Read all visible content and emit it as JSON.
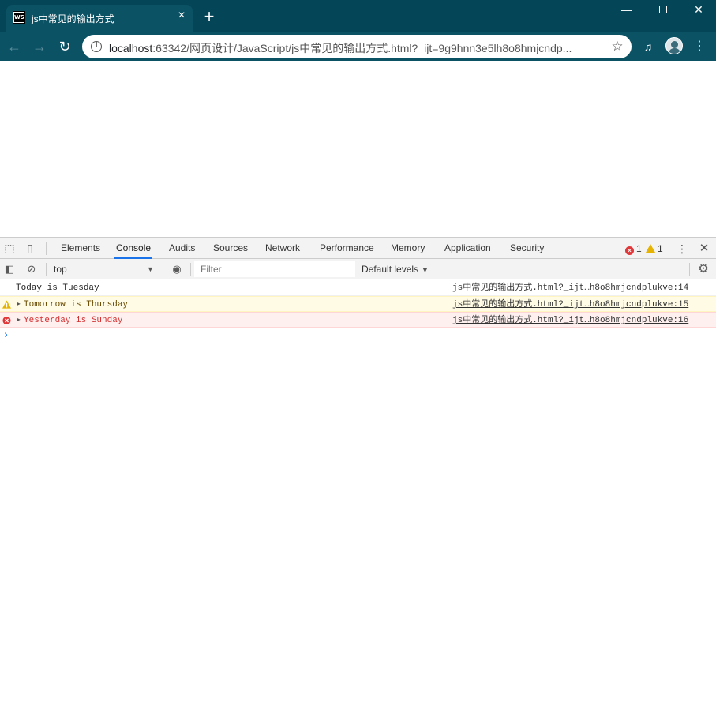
{
  "browser": {
    "tab_title": "js中常见的输出方式",
    "favicon_text": "WS",
    "new_tab_label": "+",
    "url_host": "localhost",
    "url_rest": ":63342/网页设计/JavaScript/js中常见的输出方式.html?_ijt=9g9hnn3e5lh8o8hmjcndp...",
    "window_controls": [
      "minimize-icon",
      "maximize-icon",
      "close-icon"
    ]
  },
  "devtools": {
    "tabs": [
      "Elements",
      "Console",
      "Audits",
      "Sources",
      "Network",
      "Performance",
      "Memory",
      "Application",
      "Security"
    ],
    "active_tab": "Console",
    "error_count": "1",
    "warning_count": "1",
    "context": "top",
    "filter_placeholder": "Filter",
    "levels": "Default levels",
    "messages": [
      {
        "level": "log",
        "text": "Today is Tuesday",
        "source": "js中常见的输出方式.html?_ijt…h8o8hmjcndplukve:14"
      },
      {
        "level": "warning",
        "text": "Tomorrow is Thursday",
        "source": "js中常见的输出方式.html?_ijt…h8o8hmjcndplukve:15"
      },
      {
        "level": "error",
        "text": "Yesterday is Sunday",
        "source": "js中常见的输出方式.html?_ijt…h8o8hmjcndplukve:16"
      }
    ],
    "colors": {
      "accent": "#1a73e8",
      "error": "#e0383a",
      "warning": "#e6b400"
    }
  }
}
